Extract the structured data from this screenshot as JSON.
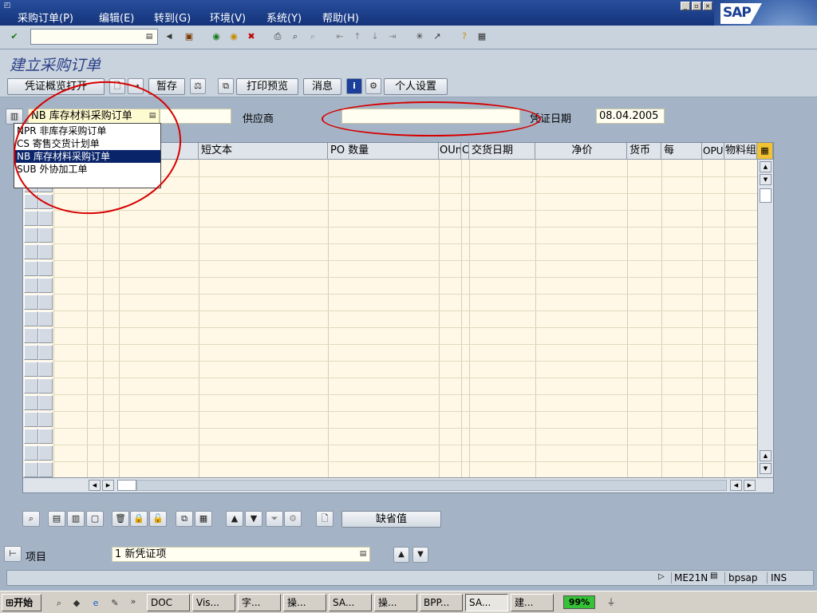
{
  "menubar": {
    "items": [
      "采购订单(P)",
      "编辑(E)",
      "转到(G)",
      "环境(V)",
      "系统(Y)",
      "帮助(H)"
    ],
    "sap_logo": "SAP",
    "window_controls": [
      "_",
      "▫",
      "×"
    ]
  },
  "std_toolbar": {
    "command_field_value": "",
    "icons": [
      "check-icon",
      "save-icon",
      "back-icon",
      "exit-icon",
      "cancel-icon",
      "print-icon",
      "find-icon",
      "find-next-icon",
      "first-page-icon",
      "prev-page-icon",
      "next-page-icon",
      "last-page-icon",
      "new-session-icon",
      "shortcut-icon",
      "help-icon",
      "layout-icon"
    ]
  },
  "title": "建立采购订单",
  "app_toolbar": {
    "doc_overview": "凭证概览打开",
    "hold": "暂存",
    "print_preview": "打印预览",
    "messages": "消息",
    "personal_settings": "个人设置"
  },
  "header": {
    "order_type_value": "NB 库存材料采购订单",
    "vendor_label": "供应商",
    "vendor_value": "",
    "doc_date_label": "凭证日期",
    "doc_date_value": "08.04.2005"
  },
  "dropdown": {
    "options": [
      {
        "label": "NPR 非库存采购订单",
        "selected": false
      },
      {
        "label": "CS  寄售交货计划单",
        "selected": false
      },
      {
        "label": "NB  库存材料采购订单",
        "selected": true
      },
      {
        "label": "SUB 外协加工单",
        "selected": false
      }
    ]
  },
  "grid": {
    "columns": [
      "短文本",
      "PO 数量",
      "OUn",
      "C",
      "交货日期",
      "净价",
      "货币",
      "每",
      "OPU",
      "物料组"
    ]
  },
  "item_area": {
    "default_button": "缺省值",
    "item_label": "项目",
    "item_value": "1 新凭证项"
  },
  "statusbar": {
    "transaction": "ME21N",
    "server": "bpsap",
    "mode": "INS"
  },
  "taskbar": {
    "start": "开始",
    "tasks": [
      "DOC",
      "Vis...",
      "字...",
      "操...",
      "SA...",
      "操...",
      "BPP...",
      "SA...",
      "建..."
    ],
    "battery": "99%"
  },
  "colors": {
    "menubar": "#1c3e8a",
    "background": "#a4b4c6",
    "field": "#fffef0",
    "selection": "#0a246a",
    "annotation": "#d60000"
  }
}
